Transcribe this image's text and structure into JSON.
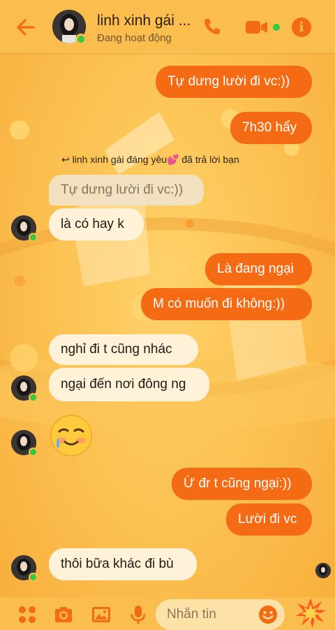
{
  "header": {
    "contact_name": "linh xinh gái ...",
    "status": "Đang hoạt động",
    "icons": [
      "back-arrow-icon",
      "phone-icon",
      "video-camera-icon",
      "info-icon"
    ]
  },
  "reply_note": {
    "text": "linh xinh gái đáng yêu",
    "heart": "💕",
    "suffix": "đã trả lời bạn"
  },
  "messages": [
    {
      "side": "out",
      "text": "Tự dưng lười đi vc:))"
    },
    {
      "side": "out",
      "text": "7h30 hẩy"
    },
    {
      "side": "quoted",
      "text": "Tự dưng lười đi vc:))"
    },
    {
      "side": "in",
      "text": "là có hay k"
    },
    {
      "side": "out",
      "text": "Là đang ngại"
    },
    {
      "side": "out",
      "text": "M có muốn đi không:))"
    },
    {
      "side": "in",
      "text": "nghỉ đi t cũng nhác"
    },
    {
      "side": "in",
      "text": "ngại đến nơi đông ng"
    },
    {
      "side": "in",
      "text": "🥲",
      "kind": "emoji"
    },
    {
      "side": "out",
      "text": "Ừ đr t cũng ngại:))"
    },
    {
      "side": "out",
      "text": "Lười đi vc"
    },
    {
      "side": "in",
      "text": "thôi bữa khác đi bù"
    }
  ],
  "composer": {
    "placeholder": "Nhắn tin",
    "icons": [
      "apps-icon",
      "camera-icon",
      "gallery-icon",
      "microphone-icon",
      "emoji-icon",
      "reaction-send-icon"
    ]
  },
  "colors": {
    "accent": "#f56b13",
    "background": "#fbbd4e",
    "incoming_bubble": "#fff2d9",
    "online": "#35c940"
  }
}
